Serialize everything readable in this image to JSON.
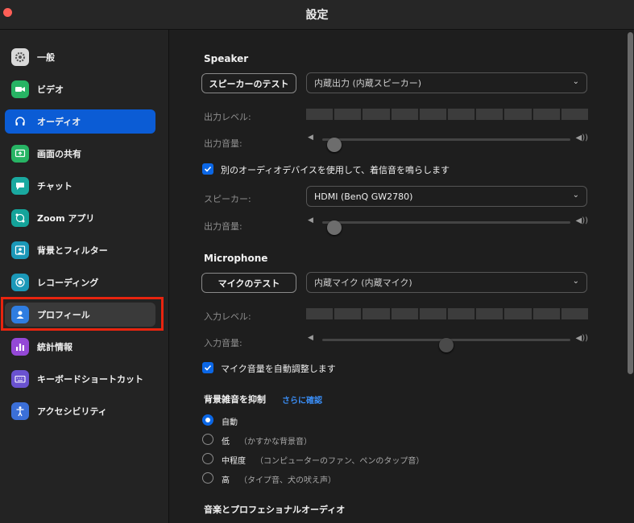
{
  "window": {
    "title": "設定"
  },
  "sidebar": {
    "items": [
      {
        "label": "一般",
        "icon": "gear-icon",
        "color": "#d9d9d9"
      },
      {
        "label": "ビデオ",
        "icon": "video-camera-icon",
        "color": "#27b464"
      },
      {
        "label": "オーディオ",
        "icon": "headphones-icon",
        "color": "#0b5cd5",
        "state": "selected"
      },
      {
        "label": "画面の共有",
        "icon": "share-screen-icon",
        "color": "#27b464"
      },
      {
        "label": "チャット",
        "icon": "chat-bubble-icon",
        "color": "#1aa9a0"
      },
      {
        "label": "Zoom アプリ",
        "icon": "apps-icon",
        "color": "#14a39a"
      },
      {
        "label": "背景とフィルター",
        "icon": "background-icon",
        "color": "#1b98b8"
      },
      {
        "label": "レコーディング",
        "icon": "record-icon",
        "color": "#1b98b8"
      },
      {
        "label": "プロフィール",
        "icon": "profile-icon",
        "color": "#2f7de1",
        "state": "highlighted"
      },
      {
        "label": "統計情報",
        "icon": "bar-chart-icon",
        "color": "#9448d6"
      },
      {
        "label": "キーボードショートカット",
        "icon": "keyboard-icon",
        "color": "#6a52d0"
      },
      {
        "label": "アクセシビリティ",
        "icon": "accessibility-icon",
        "color": "#3b6fd8"
      }
    ]
  },
  "speaker": {
    "section_title": "Speaker",
    "test_button": "スピーカーのテスト",
    "device": "内蔵出力 (内蔵スピーカー)",
    "output_level_label": "出力レベル:",
    "output_volume_label": "出力音量:",
    "volume": 0.05
  },
  "ringtone": {
    "checkbox_label": "別のオーディオデバイスを使用して、着信音を鳴らします",
    "checked": true,
    "speaker_label": "スピーカー:",
    "device": "HDMI (BenQ GW2780)",
    "output_volume_label": "出力音量:",
    "volume": 0.05
  },
  "microphone": {
    "section_title": "Microphone",
    "test_button": "マイクのテスト",
    "device": "内蔵マイク (内蔵マイク)",
    "input_level_label": "入力レベル:",
    "input_volume_label": "入力音量:",
    "volume": 0.5,
    "auto_adjust_label": "マイク音量を自動調整します",
    "auto_adjust_checked": true
  },
  "noise": {
    "title": "背景雑音を抑制",
    "learn_more": "さらに確認",
    "options": [
      {
        "label": "自動",
        "note": "",
        "selected": true
      },
      {
        "label": "低",
        "note": "（かすかな背景音）",
        "selected": false
      },
      {
        "label": "中程度",
        "note": "（コンピューターのファン、ペンのタップ音）",
        "selected": false
      },
      {
        "label": "高",
        "note": "（タイプ音、犬の吠え声）",
        "selected": false
      }
    ]
  },
  "music": {
    "title": "音楽とプロフェショナルオーディオ"
  }
}
